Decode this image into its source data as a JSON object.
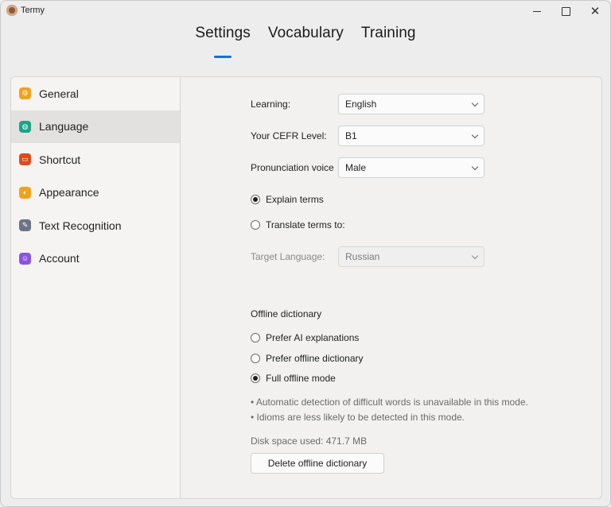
{
  "app": {
    "title": "Termy"
  },
  "window_controls": {
    "minimize": "minimize",
    "maximize": "maximize",
    "close": "✕"
  },
  "top_tabs": [
    {
      "label": "Settings",
      "active": true
    },
    {
      "label": "Vocabulary",
      "active": false
    },
    {
      "label": "Training",
      "active": false
    }
  ],
  "sidebar": {
    "items": [
      {
        "label": "General",
        "icon": "gear-icon",
        "color": "#f0a21e",
        "active": false
      },
      {
        "label": "Language",
        "icon": "globe-icon",
        "color": "#1aa587",
        "active": true
      },
      {
        "label": "Shortcut",
        "icon": "keyboard-icon",
        "color": "#e0491d",
        "active": false
      },
      {
        "label": "Appearance",
        "icon": "palette-icon",
        "color": "#f0a21e",
        "active": false
      },
      {
        "label": "Text Recognition",
        "icon": "pen-icon",
        "color": "#6a7585",
        "active": false
      },
      {
        "label": "Account",
        "icon": "user-icon",
        "color": "#8a55e0",
        "active": false
      }
    ]
  },
  "language": {
    "learning": {
      "label": "Learning:",
      "value": "English"
    },
    "cefr": {
      "label": "Your CEFR Level:",
      "value": "B1"
    },
    "voice": {
      "label": "Pronunciation voice",
      "value": "Male"
    },
    "mode": {
      "explain_label": "Explain terms",
      "translate_label": "Translate terms to:",
      "selected": "explain"
    },
    "target": {
      "label": "Target Language:",
      "value": "Russian",
      "disabled": true
    },
    "offline": {
      "title": "Offline dictionary",
      "options": [
        {
          "label": "Prefer AI explanations",
          "selected": false
        },
        {
          "label": "Prefer offline dictionary",
          "selected": false
        },
        {
          "label": "Full offline mode",
          "selected": true
        }
      ],
      "notes": [
        "• Automatic detection of difficult words is unavailable in this mode.",
        "• Idioms are less likely to be detected in this mode."
      ],
      "disk_space": "Disk space used: 471.7 MB",
      "delete_button": "Delete offline dictionary"
    }
  },
  "colors": {
    "accent": "#1b6fd0"
  }
}
